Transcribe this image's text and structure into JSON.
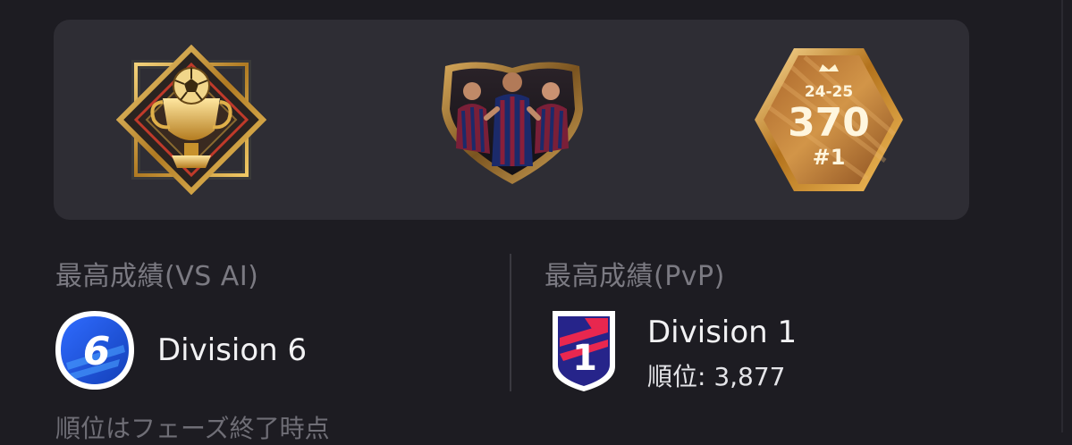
{
  "badges": [
    {
      "icon": "trophy-emblem-icon",
      "accent": "#d4a33a"
    },
    {
      "icon": "team-crest-photo-icon",
      "accent": "#a07a3a"
    },
    {
      "icon": "ranking-hexagon-icon",
      "accent": "#c98a3e",
      "season": "24-25",
      "points": "370",
      "rank": "#1"
    }
  ],
  "vs_ai": {
    "label": "最高成績(VS AI)",
    "division": "Division 6",
    "icon": "division-6-badge-icon",
    "badge_color": "#1f56d8"
  },
  "pvp": {
    "label": "最高成績(PvP)",
    "division": "Division 1",
    "rank_text": "順位: 3,877",
    "icon": "division-1-badge-icon",
    "badge_color": "#2b2a8f"
  },
  "footnote": "順位はフェーズ終了時点"
}
